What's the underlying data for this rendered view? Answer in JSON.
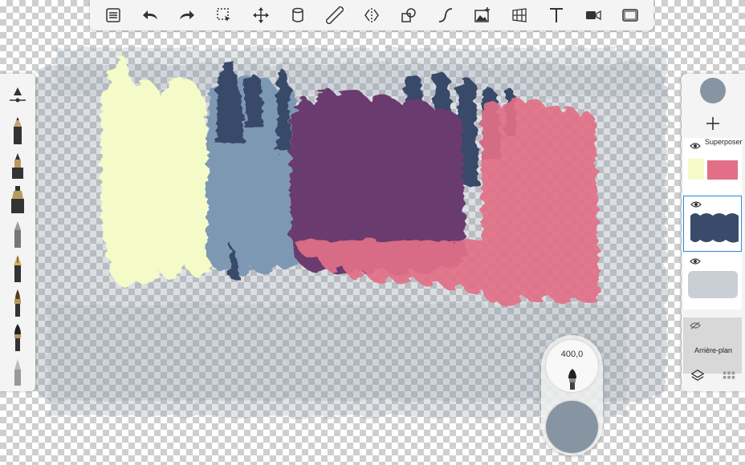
{
  "toolbar": {
    "tools": [
      {
        "name": "list-icon"
      },
      {
        "name": "undo-icon"
      },
      {
        "name": "redo-icon"
      },
      {
        "name": "selection-icon"
      },
      {
        "name": "transform-icon"
      },
      {
        "name": "fill-icon"
      },
      {
        "name": "ruler-icon"
      },
      {
        "name": "symmetry-icon"
      },
      {
        "name": "shapes-icon"
      },
      {
        "name": "curve-icon"
      },
      {
        "name": "add-image-icon"
      },
      {
        "name": "perspective-grid-icon"
      },
      {
        "name": "text-icon"
      },
      {
        "name": "video-icon"
      },
      {
        "name": "fullscreen-icon"
      }
    ]
  },
  "brushes": [
    "brush-size-slider-icon",
    "pencil-icon",
    "ballpoint-icon",
    "marker-icon",
    "airbrush-icon",
    "fountain-pen-icon",
    "paintbrush-icon",
    "ink-brush-icon",
    "smudge-icon"
  ],
  "layers": {
    "current_color": "#8795a2",
    "items": [
      {
        "blend_mode": "Superposer",
        "visible": true,
        "selected": false
      },
      {
        "blend_mode": "",
        "visible": true,
        "selected": true
      },
      {
        "blend_mode": "",
        "visible": true,
        "selected": false
      }
    ],
    "background": {
      "label": "Arrière-plan",
      "visible": false
    }
  },
  "puck": {
    "brush_size": "400,0",
    "color": "#8795a2"
  },
  "colors": {
    "cream": "#f4fbc8",
    "blue": "#7d98b2",
    "navy": "#394a6b",
    "plum": "#6a3b6e",
    "pink": "#e26f87",
    "grey": "#8795a2",
    "accent": "#2d8be0"
  }
}
